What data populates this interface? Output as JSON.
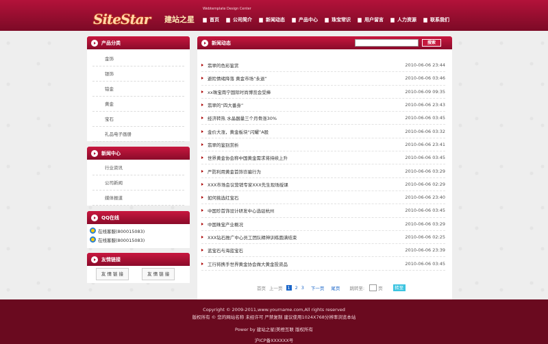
{
  "header": {
    "logo_sub": "Webtemplate Design Center",
    "logo_main": "SiteStar",
    "logo_cn": "建站之星",
    "nav": [
      "首页",
      "公司简介",
      "新闻动态",
      "产品中心",
      "珠宝常识",
      "用户留言",
      "人力资源",
      "联系我们"
    ]
  },
  "sidebar": {
    "products": {
      "title": "产品分类",
      "items": [
        "金饰",
        "银饰",
        "铂金",
        "黄金",
        "宝石",
        "礼品电子画册"
      ]
    },
    "news": {
      "title": "新闻中心",
      "items": [
        "行业资讯",
        "公司新闻",
        "媒体报道"
      ]
    },
    "qq": {
      "title": "QQ在线",
      "items": [
        "在线客服(800015083)",
        "在线客服(800015083)"
      ]
    },
    "links": {
      "title": "友情链接",
      "items": [
        "友 情 链 接",
        "友 情 链 接"
      ]
    }
  },
  "main": {
    "title": "新闻动态",
    "search_button": "搜索",
    "news": [
      {
        "title": "翡翠的色彩鉴赏",
        "date": "2010-06-06 23:44"
      },
      {
        "title": "避险情绪降落 黄金市场“永退”",
        "date": "2010-06-06 03:46"
      },
      {
        "title": "xx珠宝南宁国际时尚博览会受捧",
        "date": "2010-06-09 09:35"
      },
      {
        "title": "翡翠的“四大番身”",
        "date": "2010-06-06 23:43"
      },
      {
        "title": "经济转热 水晶器量三个月骨涨30%",
        "date": "2010-06-06 03:45"
      },
      {
        "title": "金价大涨，黄金板块“闪耀”A股",
        "date": "2010-06-06 03:32"
      },
      {
        "title": "翡翠的鉴别赏析",
        "date": "2010-06-06 23:41"
      },
      {
        "title": "世界黄金协会称中国黄金需求将持续上升",
        "date": "2010-06-06 03:45"
      },
      {
        "title": "严防利用黄金首饰诈骗行为",
        "date": "2010-06-06 03:29"
      },
      {
        "title": "XXX市场会议营销专家XXX先生现场授课",
        "date": "2010-06-06 02:29"
      },
      {
        "title": "如何挑选红宝石",
        "date": "2010-06-06 23:40"
      },
      {
        "title": "中国珍首饰设计研发中心选驻杭州",
        "date": "2010-06-06 03:45"
      },
      {
        "title": "中国珠宝产业概况",
        "date": "2010-06-06 03:29"
      },
      {
        "title": "XXX钻石推广中心员工团队精神训练圆满结束",
        "date": "2010-06-06 02:25"
      },
      {
        "title": "蓝宝石与海蓝宝石",
        "date": "2010-06-06 23:39"
      },
      {
        "title": "工行将携手世界黄金协会做大黄金投资品",
        "date": "2010-06-06 03:45"
      }
    ],
    "pager": {
      "first": "首页",
      "prev": "上一页",
      "pages": [
        "1",
        "2",
        "3"
      ],
      "next": "下一页",
      "last": "尾页",
      "goto_label": "跳转至:",
      "page_unit": "页",
      "goto_button": "转至"
    }
  },
  "footer": {
    "line1": "Copyright © 2009-2011,www.yourname.com,All rights reserved",
    "line2": "版权所有 © 您的网站名称 未经许可 严禁复制 建议使用1024X768分辨率浏览本站",
    "line3": "Power by 建站之星|美橙互联 版权所有",
    "line4": "沪ICP备XXXXXX号"
  }
}
